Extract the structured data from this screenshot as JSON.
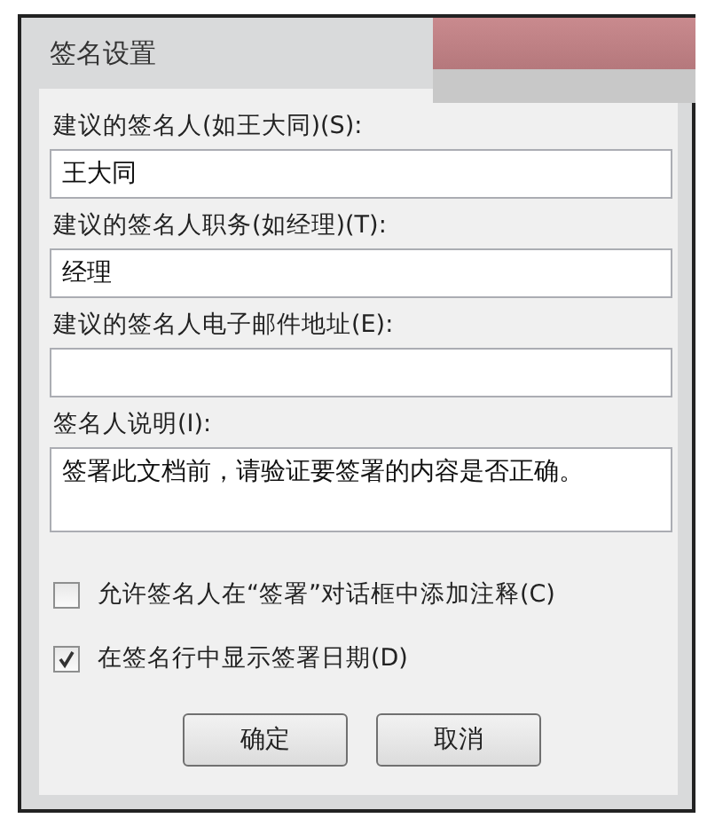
{
  "window": {
    "title": "签名设置"
  },
  "fields": [
    {
      "kind": "line",
      "label": "建议的签名人(如王大同)(S):",
      "value": "王大同"
    },
    {
      "kind": "line",
      "label": "建议的签名人职务(如经理)(T):",
      "value": "经理"
    },
    {
      "kind": "line",
      "label": "建议的签名人电子邮件地址(E):"
    },
    {
      "kind": "area",
      "label": "签名人说明(I):",
      "value": "签署此文档前，请验证要签署的内容是否正确。"
    }
  ],
  "checkboxes": [
    {
      "label": "允许签名人在“签署”对话框中添加注释(C)",
      "checked": false
    },
    {
      "label": "在签名行中显示签署日期(D)",
      "checked": true
    }
  ],
  "buttons": [
    "确定",
    "取消"
  ]
}
